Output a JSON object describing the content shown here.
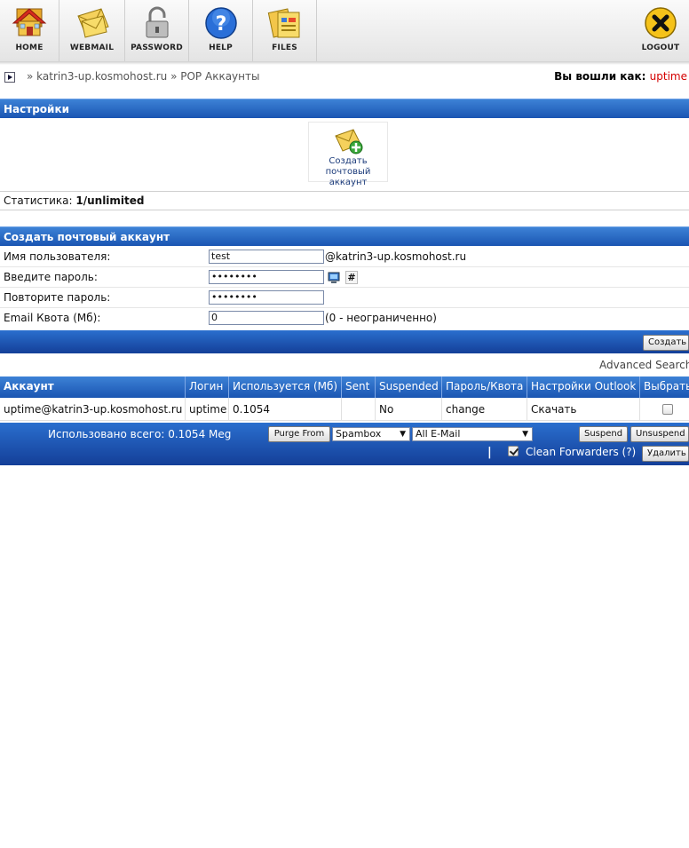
{
  "nav": {
    "home": "HOME",
    "webmail": "WEBMAIL",
    "password": "PASSWORD",
    "help": "HELP",
    "files": "FILES",
    "logout": "LOGOUT"
  },
  "breadcrumb": {
    "domain": "katrin3-up.kosmohost.ru",
    "page": "POP Аккаунты",
    "separator": "»"
  },
  "session": {
    "logged_in_label": "Вы вошли как:",
    "user": "uptime"
  },
  "settings": {
    "title": "Настройки",
    "create_icon_label": "Создать почтовый аккаунт",
    "stats_label": "Статистика:",
    "stats_value": "1/unlimited"
  },
  "create_form": {
    "title": "Создать почтовый аккаунт",
    "username_label": "Имя пользователя:",
    "username_value": "test",
    "domain_suffix": "@katrin3-up.kosmohost.ru",
    "password_label": "Введите пароль:",
    "password_value": "••••••••",
    "confirm_label": "Повторите пароль:",
    "confirm_value": "••••••••",
    "quota_label": "Email Квота (Мб):",
    "quota_value": "0",
    "quota_hint": "(0 - неограниченно)",
    "generate_symbol": "#",
    "create_button": "Создать"
  },
  "advanced_search": "Advanced Search",
  "table": {
    "headers": [
      "Аккаунт",
      "Логин",
      "Используется (Мб)",
      "Sent",
      "Suspended",
      "Пароль/Квота",
      "Настройки Outlook",
      "Выбрать"
    ],
    "rows": [
      {
        "account": "uptime@katrin3-up.kosmohost.ru",
        "login": "uptime",
        "used": "0.1054",
        "sent": "",
        "suspended": "No",
        "password": "change",
        "outlook": "Скачать"
      }
    ]
  },
  "footer": {
    "total_used": "Использовано всего: 0.1054 Meg",
    "purge_button": "Purge From",
    "purge_select": "Spambox",
    "target_select": "All E-Mail",
    "suspend_button": "Suspend",
    "unsuspend_button": "Unsuspend",
    "divider": "|",
    "clean_forwarders": "Clean Forwarders (?)",
    "delete_button": "Удалить"
  },
  "colors": {
    "header_blue": "#1a55b2",
    "user_red": "#d40000"
  }
}
